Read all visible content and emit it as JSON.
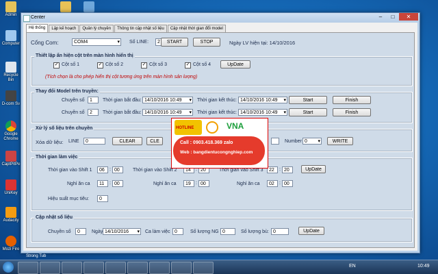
{
  "desktop": {
    "icons": [
      "Admin",
      "",
      "",
      "Computer",
      "Recycle Bin",
      "D-com Sv",
      "Google Chrome",
      "CaptPitPe",
      "UniKey",
      "Audacity",
      "Mozi Fire"
    ]
  },
  "window": {
    "title": "Center",
    "tabs": [
      "Hệ thống",
      "Lập kế hoạch",
      "Quản lý chuyền",
      "Thông tin cập nhật số liệu",
      "Cập nhật thời gian đổi model"
    ],
    "top": {
      "com_label": "Cổng Com:",
      "com_value": "COM4",
      "line_label": "Số LINE:",
      "line_value": "2",
      "start": "START",
      "stop": "STOP",
      "date_label": "Ngày LV hiện tại: 14/10/2016"
    },
    "display": {
      "title": "Thiết lập ẩn hiện cột trên màn hình hiển thị",
      "columns": [
        "Cột số 1",
        "Cột số 2",
        "Cột số 3",
        "Cột số 4"
      ],
      "update": "UpDate",
      "note": "(Tích chọn là cho phép hiển thị cột tương ứng trên màn hình sản lượng)"
    },
    "model": {
      "title": "Thay đổi Model trên truyền:",
      "line_label": "Chuyền số",
      "start_label": "Thời gian bắt đầu:",
      "end_label": "Thời gian kết thúc:",
      "rows": [
        {
          "line": "1",
          "start": "14/10/2016 10:49",
          "end": "14/10/2016 10:49"
        },
        {
          "line": "2",
          "start": "14/10/2016 10:49",
          "end": "14/10/2016 10:49"
        }
      ],
      "start_btn": "Start",
      "finish_btn": "Finish"
    },
    "process": {
      "title": "Xử lý số liệu trên chuyền",
      "clear_label": "Xóa dữ liệu:",
      "line_label": "LINE",
      "line_value": "0",
      "clear": "CLEAR",
      "clear2": "CLE",
      "number_label": "Number",
      "number_value": "0",
      "write": "WRITE"
    },
    "work_time": {
      "title": "Thời gian làm việc",
      "shift1": "Thời gian vào Shift 1",
      "shift1_h": "06",
      "shift1_m": "00",
      "shift2": "Thời gian vào Shift 2",
      "shift2_h": "14",
      "shift2_m": "20",
      "shift3": "Thời gian vào Shift 3",
      "shift3_h": "22",
      "shift3_m": "20",
      "break_label": "Nghỉ ăn ca",
      "break1_h": "11",
      "break1_m": "00",
      "break2_h": "19",
      "break2_m": "00",
      "break3_h": "02",
      "break3_m": "00",
      "update": "UpDate",
      "eff_label": "Hiệu suất mục tiêu:",
      "eff_value": "0"
    },
    "update_data": {
      "title": "Cập nhật số liệu",
      "line_label": "Chuyền số",
      "line_value": "0",
      "date_label": "Ngày:",
      "date_value": "14/10/2016",
      "shift_label": "Ca làm việc",
      "shift_value": "0",
      "ng_label": "Số lượng NG",
      "ng_value": "0",
      "bu_label": "Số lượng bù:",
      "bu_value": "0",
      "update": "UpDate"
    }
  },
  "ad": {
    "hotline": "HOTLINE",
    "brand": "VNA",
    "call": "Call : 0903.418.369  zalo",
    "web": "Web : bangdientucongnghiep.com"
  },
  "taskbar": {
    "lang": "EN",
    "time": "10:49",
    "strip": "Strong Tub"
  },
  "colors": {
    "accent": "#c00000",
    "group_bg": "#cfdbe8",
    "desktop": "#1466b3"
  }
}
